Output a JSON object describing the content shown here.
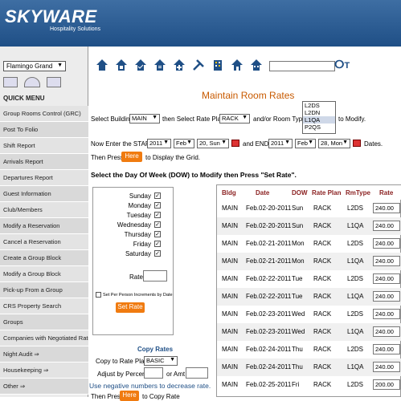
{
  "header": {
    "brand": "SKYWARE",
    "subtitle": "Hospitality Solutions"
  },
  "sidebar": {
    "property_selected": "Flamingo Grand",
    "quick_menu_title": "QUICK MENU",
    "items": [
      "Group Rooms Control (GRC)",
      "Post To Folio",
      "Shift Report",
      "Arrivals Report",
      "Departures Report",
      "Guest Information",
      "Club/Members",
      "Modify a Reservation",
      "Cancel a Reservation",
      "Create a Group Block",
      "Modify a Group Block",
      "Pick-up From a Group",
      "CRS Property Search",
      "Groups",
      "Companies with Negotiated Rates",
      "Night Audit ⇒",
      "Housekeeping ⇒",
      "Other ⇒"
    ]
  },
  "main": {
    "title": "Maintain Room Rates",
    "select_building_label": "Select Building",
    "building_value": "MAIN",
    "then_select_rate_plan_label": "then Select Rate Plan",
    "rate_plan_value": "RACK",
    "room_type_label": "and/or Room Type",
    "room_types": [
      "L2DS",
      "L2DN",
      "L1QA",
      "P2QS"
    ],
    "to_modify_label": "to Modify.",
    "enter_start_label": "Now Enter the START:",
    "start_year": "2011",
    "start_month": "Feb",
    "start_day": "20, Sun",
    "and_end_label": "and END",
    "end_year": "2011",
    "end_month": "Feb",
    "end_day": "28, Mon",
    "dates_label": "Dates.",
    "then_press_label": "Then Press",
    "here_button": "Here",
    "display_grid_label": "to Display the Grid.",
    "dow_instruction": "Select the Day Of Week (DOW) to Modify then Press \"Set Rate\".",
    "days": [
      "Sunday",
      "Monday",
      "Tuesday",
      "Wednesday",
      "Thursday",
      "Friday",
      "Saturday"
    ],
    "rate_label": "Rate",
    "per_person_label": "Set Per Person Increments by Date",
    "set_rate_button": "Set Rate",
    "copy_rates_title": "Copy Rates",
    "copy_to_label": "Copy to Rate Plan:",
    "copy_to_value": "BASIC",
    "adjust_percent_label": "Adjust by Percent:",
    "or_amt_label": "or Amt",
    "negative_note": "Use negative numbers to decrease rate.",
    "then_press_label2": "Then Press",
    "here_button2": "Here",
    "copy_rate_label": "to Copy Rate"
  },
  "table": {
    "headers": [
      "Bldg",
      "Date",
      "DOW",
      "Rate Plan",
      "RmType",
      "Rate"
    ],
    "rows": [
      [
        "MAIN",
        "Feb.02-20-2011",
        "Sun",
        "RACK",
        "L2DS",
        "240.00"
      ],
      [
        "MAIN",
        "Feb.02-20-2011",
        "Sun",
        "RACK",
        "L1QA",
        "240.00"
      ],
      [
        "MAIN",
        "Feb.02-21-2011",
        "Mon",
        "RACK",
        "L2DS",
        "240.00"
      ],
      [
        "MAIN",
        "Feb.02-21-2011",
        "Mon",
        "RACK",
        "L1QA",
        "240.00"
      ],
      [
        "MAIN",
        "Feb.02-22-2011",
        "Tue",
        "RACK",
        "L2DS",
        "240.00"
      ],
      [
        "MAIN",
        "Feb.02-22-2011",
        "Tue",
        "RACK",
        "L1QA",
        "240.00"
      ],
      [
        "MAIN",
        "Feb.02-23-2011",
        "Wed",
        "RACK",
        "L2DS",
        "240.00"
      ],
      [
        "MAIN",
        "Feb.02-23-2011",
        "Wed",
        "RACK",
        "L1QA",
        "240.00"
      ],
      [
        "MAIN",
        "Feb.02-24-2011",
        "Thu",
        "RACK",
        "L2DS",
        "240.00"
      ],
      [
        "MAIN",
        "Feb.02-24-2011",
        "Thu",
        "RACK",
        "L1QA",
        "240.00"
      ],
      [
        "MAIN",
        "Feb.02-25-2011",
        "Fri",
        "RACK",
        "L2DS",
        "200.00"
      ]
    ]
  },
  "colors": {
    "header_blue": "#1f4f86",
    "accent_orange": "#f07b10",
    "title_orange": "#c85a00",
    "table_header_red": "#8a1f1f"
  }
}
